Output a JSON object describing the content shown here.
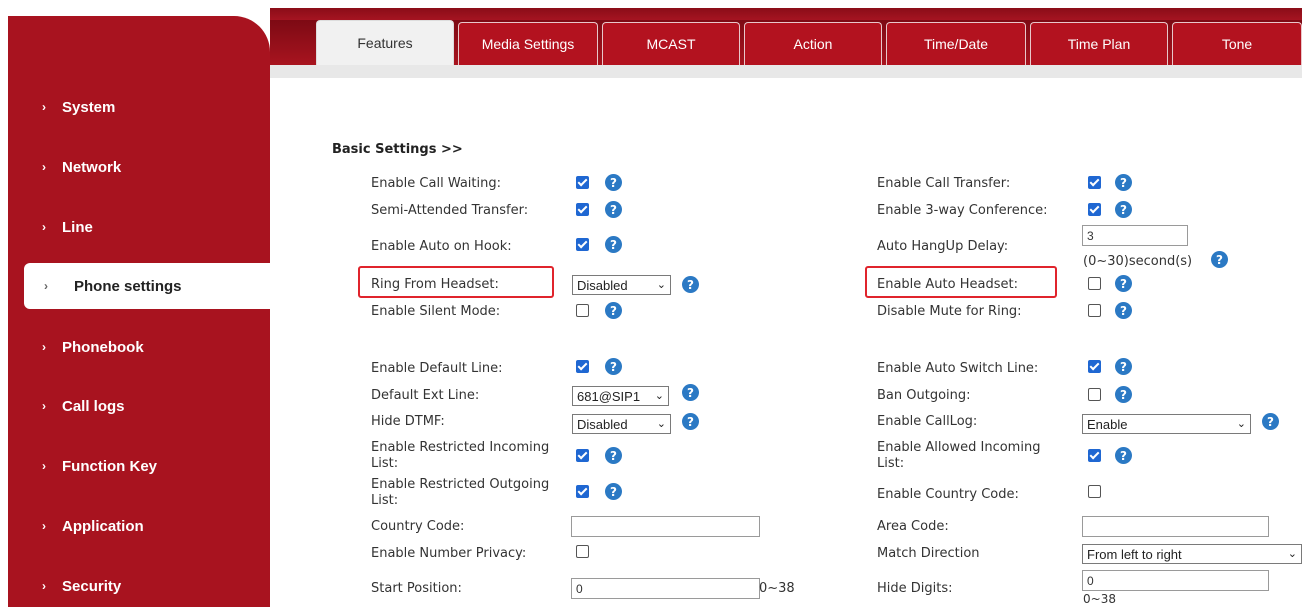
{
  "tabs": [
    {
      "label": "Features",
      "active": true
    },
    {
      "label": "Media Settings"
    },
    {
      "label": "MCAST"
    },
    {
      "label": "Action"
    },
    {
      "label": "Time/Date"
    },
    {
      "label": "Time Plan"
    },
    {
      "label": "Tone"
    }
  ],
  "sidebar": {
    "items": [
      {
        "label": "System"
      },
      {
        "label": "Network"
      },
      {
        "label": "Line"
      },
      {
        "label": "Phone settings",
        "active": true
      },
      {
        "label": "Phonebook"
      },
      {
        "label": "Call logs"
      },
      {
        "label": "Function Key"
      },
      {
        "label": "Application"
      },
      {
        "label": "Security"
      }
    ]
  },
  "section": {
    "title": "Basic Settings >>"
  },
  "left": {
    "call_waiting": "Enable Call Waiting:",
    "semi_attended": "Semi-Attended Transfer:",
    "auto_on_hook": "Enable Auto on Hook:",
    "ring_from_headset": "Ring From Headset:",
    "ring_from_headset_value": "Disabled",
    "silent_mode": "Enable Silent Mode:",
    "default_line": "Enable Default Line:",
    "default_ext_line": "Default Ext Line:",
    "default_ext_line_value": "681@SIP1",
    "hide_dtmf": "Hide DTMF:",
    "hide_dtmf_value": "Disabled",
    "restricted_incoming_1": "Enable Restricted Incoming",
    "restricted_incoming_2": "List:",
    "restricted_outgoing_1": "Enable Restricted Outgoing",
    "restricted_outgoing_2": "List:",
    "country_code": "Country Code:",
    "number_privacy": "Enable Number Privacy:",
    "start_position": "Start Position:",
    "start_position_value": "0",
    "start_position_hint": "0~38"
  },
  "right": {
    "call_transfer": "Enable Call Transfer:",
    "three_way": "Enable 3-way Conference:",
    "auto_hangup_delay": "Auto HangUp Delay:",
    "auto_hangup_value": "3",
    "auto_hangup_hint": "(0~30)second(s)",
    "auto_headset": "Enable Auto Headset:",
    "disable_mute_ring": "Disable Mute for Ring:",
    "auto_switch_line": "Enable Auto Switch Line:",
    "ban_outgoing": "Ban Outgoing:",
    "call_log": "Enable CallLog:",
    "call_log_value": "Enable",
    "allowed_incoming_1": "Enable Allowed Incoming",
    "allowed_incoming_2": "List:",
    "country_code_enable": "Enable Country Code:",
    "area_code": "Area Code:",
    "match_direction": "Match Direction",
    "match_direction_value": "From left to right",
    "hide_digits": "Hide Digits:",
    "hide_digits_value": "0",
    "hide_digits_hint": "0~38"
  },
  "glyphs": {
    "chevron": "›",
    "help": "?",
    "caret": "⌄"
  },
  "colors": {
    "brand_red": "#a8131f",
    "checkbox_blue": "#1f67d2",
    "help_blue": "#2b79c4",
    "highlight_red": "#e0242c"
  }
}
